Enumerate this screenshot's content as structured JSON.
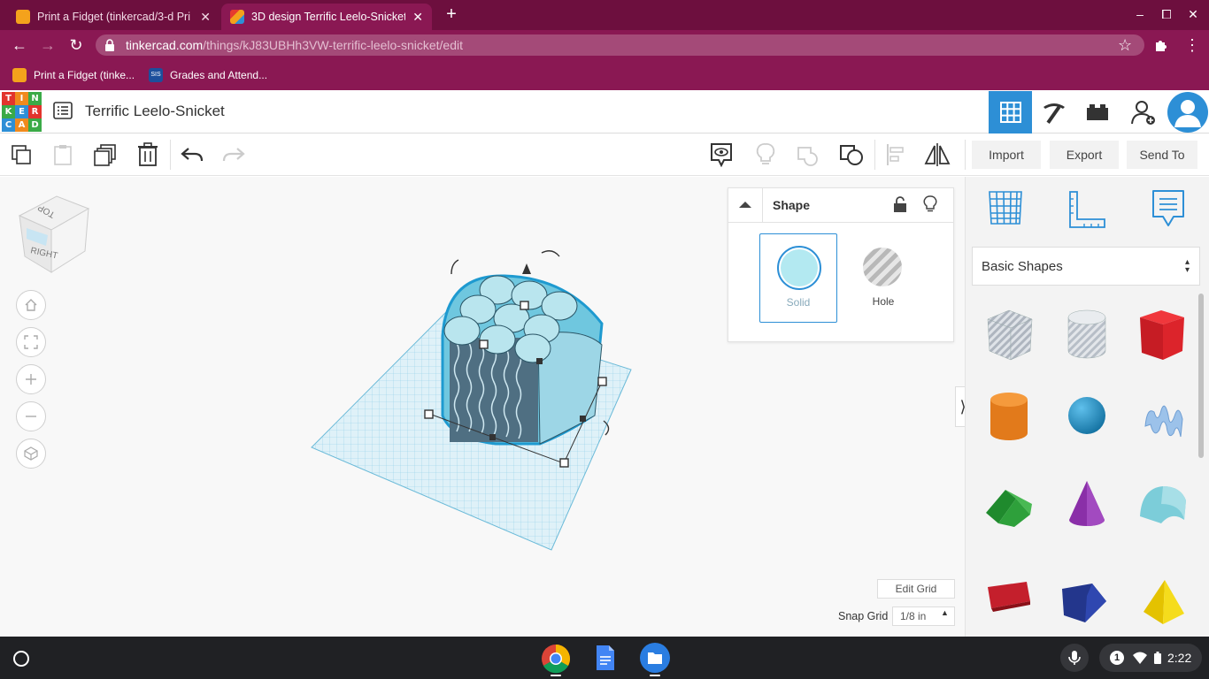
{
  "browser": {
    "tabs": [
      {
        "title": "Print a Fidget (tinkercad/3-d Pri",
        "active": false
      },
      {
        "title": "3D design Terrific Leelo-Snicket |",
        "active": true
      }
    ],
    "new_tab": "+",
    "url_host": "tinkercad.com",
    "url_path": "/things/kJ83UBHh3VW-terrific-leelo-snicket/edit",
    "bookmarks": [
      {
        "label": "Print a Fidget (tinke..."
      },
      {
        "label": "Grades and Attend..."
      }
    ],
    "controls": {
      "minimize": "–",
      "restore": "⧠",
      "close": "✕"
    }
  },
  "app": {
    "logo_letters": [
      "T",
      "I",
      "N",
      "K",
      "E",
      "R",
      "C",
      "A",
      "D"
    ],
    "design_title": "Terrific Leelo-Snicket",
    "actions": {
      "import": "Import",
      "export": "Export",
      "send_to": "Send To"
    }
  },
  "viewcube": {
    "top": "TOP",
    "right": "RIGHT",
    "front": "FRONT"
  },
  "shape_panel": {
    "title": "Shape",
    "solid_label": "Solid",
    "hole_label": "Hole",
    "colors": {
      "solid": "#b3e9f1",
      "accent": "#2d8fd6"
    }
  },
  "library": {
    "category": "Basic Shapes",
    "shapes": [
      {
        "name": "box-hole",
        "icon": "striped-box"
      },
      {
        "name": "cylinder-hole",
        "icon": "striped-cylinder"
      },
      {
        "name": "box",
        "icon": "red-box",
        "color": "#d71e25"
      },
      {
        "name": "cylinder",
        "icon": "orange-cylinder",
        "color": "#e27a1b"
      },
      {
        "name": "sphere",
        "icon": "blue-sphere",
        "color": "#1a8cc2"
      },
      {
        "name": "scribble",
        "icon": "blue-scribble",
        "color": "#8fb6e3"
      },
      {
        "name": "roof",
        "icon": "green-roof",
        "color": "#2d9e3a"
      },
      {
        "name": "cone",
        "icon": "purple-cone",
        "color": "#8a2fa8"
      },
      {
        "name": "round-roof",
        "icon": "teal-roof",
        "color": "#6ec6d4"
      },
      {
        "name": "text",
        "icon": "red-text",
        "color": "#c41f2c"
      },
      {
        "name": "box-wedge",
        "icon": "navy-box",
        "color": "#23368c"
      },
      {
        "name": "pyramid",
        "icon": "yellow-pyramid",
        "color": "#f2d000"
      }
    ]
  },
  "grid": {
    "edit_grid": "Edit Grid",
    "snap_label": "Snap Grid",
    "snap_value": "1/8 in"
  },
  "taskbar": {
    "notification_count": "1",
    "time": "2:22"
  }
}
